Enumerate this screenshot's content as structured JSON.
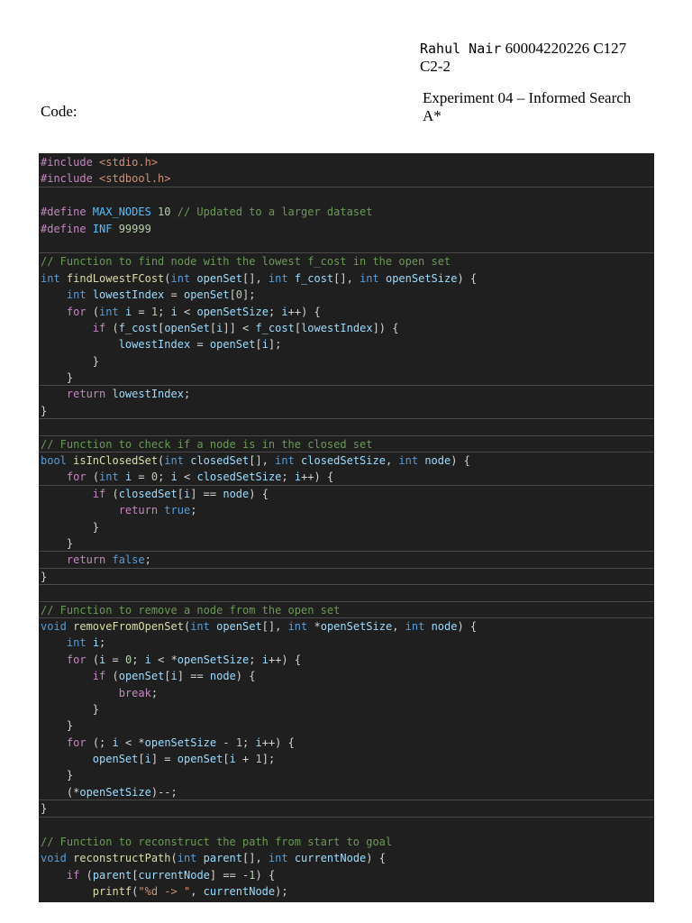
{
  "header": {
    "name": "Rahul  Nair",
    "id_line": " 60004220226 C127",
    "batch": "C2-2",
    "experiment_line1": "Experiment 04 – Informed Search",
    "experiment_line2": "A*",
    "code_label": "Code:"
  },
  "code_lines": [
    [
      [
        "kw",
        "#include "
      ],
      [
        "str",
        "<stdio.h>"
      ]
    ],
    [
      [
        "kw",
        "#include "
      ],
      [
        "str",
        "<stdbool.h>"
      ]
    ],
    [],
    [
      [
        "kw",
        "#define "
      ],
      [
        "mac",
        "MAX_NODES "
      ],
      [
        "num",
        "10 "
      ],
      [
        "com",
        "// Updated to a larger dataset"
      ]
    ],
    [
      [
        "kw",
        "#define "
      ],
      [
        "mac",
        "INF "
      ],
      [
        "num",
        "99999"
      ]
    ],
    [],
    [
      [
        "com",
        "// Function to find node with the lowest f_cost in the open set"
      ]
    ],
    [
      [
        "type",
        "int "
      ],
      [
        "fn",
        "findLowestFCost"
      ],
      [
        "p",
        "("
      ],
      [
        "type",
        "int "
      ],
      [
        "var",
        "openSet"
      ],
      [
        "p",
        "[], "
      ],
      [
        "type",
        "int "
      ],
      [
        "var",
        "f_cost"
      ],
      [
        "p",
        "[], "
      ],
      [
        "type",
        "int "
      ],
      [
        "var",
        "openSetSize"
      ],
      [
        "p",
        ") {"
      ]
    ],
    [
      [
        "p",
        "    "
      ],
      [
        "type",
        "int "
      ],
      [
        "var",
        "lowestIndex"
      ],
      [
        "p",
        " = "
      ],
      [
        "var",
        "openSet"
      ],
      [
        "p",
        "["
      ],
      [
        "num",
        "0"
      ],
      [
        "p",
        "];"
      ]
    ],
    [
      [
        "p",
        "    "
      ],
      [
        "kw",
        "for "
      ],
      [
        "p",
        "("
      ],
      [
        "type",
        "int "
      ],
      [
        "var",
        "i"
      ],
      [
        "p",
        " = "
      ],
      [
        "num",
        "1"
      ],
      [
        "p",
        "; "
      ],
      [
        "var",
        "i"
      ],
      [
        "p",
        " < "
      ],
      [
        "var",
        "openSetSize"
      ],
      [
        "p",
        "; "
      ],
      [
        "var",
        "i"
      ],
      [
        "p",
        "++) {"
      ]
    ],
    [
      [
        "p",
        "        "
      ],
      [
        "kw",
        "if "
      ],
      [
        "p",
        "("
      ],
      [
        "var",
        "f_cost"
      ],
      [
        "p",
        "["
      ],
      [
        "var",
        "openSet"
      ],
      [
        "p",
        "["
      ],
      [
        "var",
        "i"
      ],
      [
        "p",
        "]] < "
      ],
      [
        "var",
        "f_cost"
      ],
      [
        "p",
        "["
      ],
      [
        "var",
        "lowestIndex"
      ],
      [
        "p",
        "]) {"
      ]
    ],
    [
      [
        "p",
        "            "
      ],
      [
        "var",
        "lowestIndex"
      ],
      [
        "p",
        " = "
      ],
      [
        "var",
        "openSet"
      ],
      [
        "p",
        "["
      ],
      [
        "var",
        "i"
      ],
      [
        "p",
        "];"
      ]
    ],
    [
      [
        "p",
        "        }"
      ]
    ],
    [
      [
        "p",
        "    }"
      ]
    ],
    [
      [
        "p",
        "    "
      ],
      [
        "kw",
        "return "
      ],
      [
        "var",
        "lowestIndex"
      ],
      [
        "p",
        ";"
      ]
    ],
    [
      [
        "p",
        "}"
      ]
    ],
    [],
    [
      [
        "com",
        "// Function to check if a node is in the closed set"
      ]
    ],
    [
      [
        "type",
        "bool "
      ],
      [
        "fn",
        "isInClosedSet"
      ],
      [
        "p",
        "("
      ],
      [
        "type",
        "int "
      ],
      [
        "var",
        "closedSet"
      ],
      [
        "p",
        "[], "
      ],
      [
        "type",
        "int "
      ],
      [
        "var",
        "closedSetSize"
      ],
      [
        "p",
        ", "
      ],
      [
        "type",
        "int "
      ],
      [
        "var",
        "node"
      ],
      [
        "p",
        ") {"
      ]
    ],
    [
      [
        "p",
        "    "
      ],
      [
        "kw",
        "for "
      ],
      [
        "p",
        "("
      ],
      [
        "type",
        "int "
      ],
      [
        "var",
        "i"
      ],
      [
        "p",
        " = "
      ],
      [
        "num",
        "0"
      ],
      [
        "p",
        "; "
      ],
      [
        "var",
        "i"
      ],
      [
        "p",
        " < "
      ],
      [
        "var",
        "closedSetSize"
      ],
      [
        "p",
        "; "
      ],
      [
        "var",
        "i"
      ],
      [
        "p",
        "++) {"
      ]
    ],
    [
      [
        "p",
        "        "
      ],
      [
        "kw",
        "if "
      ],
      [
        "p",
        "("
      ],
      [
        "var",
        "closedSet"
      ],
      [
        "p",
        "["
      ],
      [
        "var",
        "i"
      ],
      [
        "p",
        "] == "
      ],
      [
        "var",
        "node"
      ],
      [
        "p",
        ") {"
      ]
    ],
    [
      [
        "p",
        "            "
      ],
      [
        "kw",
        "return "
      ],
      [
        "type",
        "true"
      ],
      [
        "p",
        ";"
      ]
    ],
    [
      [
        "p",
        "        }"
      ]
    ],
    [
      [
        "p",
        "    }"
      ]
    ],
    [
      [
        "p",
        "    "
      ],
      [
        "kw",
        "return "
      ],
      [
        "type",
        "false"
      ],
      [
        "p",
        ";"
      ]
    ],
    [
      [
        "p",
        "}"
      ]
    ],
    [],
    [
      [
        "com",
        "// Function to remove a node from the open set"
      ]
    ],
    [
      [
        "type",
        "void "
      ],
      [
        "fn",
        "removeFromOpenSet"
      ],
      [
        "p",
        "("
      ],
      [
        "type",
        "int "
      ],
      [
        "var",
        "openSet"
      ],
      [
        "p",
        "[], "
      ],
      [
        "type",
        "int "
      ],
      [
        "p",
        "*"
      ],
      [
        "var",
        "openSetSize"
      ],
      [
        "p",
        ", "
      ],
      [
        "type",
        "int "
      ],
      [
        "var",
        "node"
      ],
      [
        "p",
        ") {"
      ]
    ],
    [
      [
        "p",
        "    "
      ],
      [
        "type",
        "int "
      ],
      [
        "var",
        "i"
      ],
      [
        "p",
        ";"
      ]
    ],
    [
      [
        "p",
        "    "
      ],
      [
        "kw",
        "for "
      ],
      [
        "p",
        "("
      ],
      [
        "var",
        "i"
      ],
      [
        "p",
        " = "
      ],
      [
        "num",
        "0"
      ],
      [
        "p",
        "; "
      ],
      [
        "var",
        "i"
      ],
      [
        "p",
        " < *"
      ],
      [
        "var",
        "openSetSize"
      ],
      [
        "p",
        "; "
      ],
      [
        "var",
        "i"
      ],
      [
        "p",
        "++) {"
      ]
    ],
    [
      [
        "p",
        "        "
      ],
      [
        "kw",
        "if "
      ],
      [
        "p",
        "("
      ],
      [
        "var",
        "openSet"
      ],
      [
        "p",
        "["
      ],
      [
        "var",
        "i"
      ],
      [
        "p",
        "] == "
      ],
      [
        "var",
        "node"
      ],
      [
        "p",
        ") {"
      ]
    ],
    [
      [
        "p",
        "            "
      ],
      [
        "kw",
        "break"
      ],
      [
        "p",
        ";"
      ]
    ],
    [
      [
        "p",
        "        }"
      ]
    ],
    [
      [
        "p",
        "    }"
      ]
    ],
    [
      [
        "p",
        "    "
      ],
      [
        "kw",
        "for "
      ],
      [
        "p",
        "(; "
      ],
      [
        "var",
        "i"
      ],
      [
        "p",
        " < *"
      ],
      [
        "var",
        "openSetSize"
      ],
      [
        "p",
        " - "
      ],
      [
        "num",
        "1"
      ],
      [
        "p",
        "; "
      ],
      [
        "var",
        "i"
      ],
      [
        "p",
        "++) {"
      ]
    ],
    [
      [
        "p",
        "        "
      ],
      [
        "var",
        "openSet"
      ],
      [
        "p",
        "["
      ],
      [
        "var",
        "i"
      ],
      [
        "p",
        "] = "
      ],
      [
        "var",
        "openSet"
      ],
      [
        "p",
        "["
      ],
      [
        "var",
        "i"
      ],
      [
        "p",
        " + "
      ],
      [
        "num",
        "1"
      ],
      [
        "p",
        "];"
      ]
    ],
    [
      [
        "p",
        "    }"
      ]
    ],
    [
      [
        "p",
        "    (*"
      ],
      [
        "var",
        "openSetSize"
      ],
      [
        "p",
        ")--;"
      ]
    ],
    [
      [
        "p",
        "}"
      ]
    ],
    [],
    [
      [
        "com",
        "// Function to reconstruct the path from start to goal"
      ]
    ],
    [
      [
        "type",
        "void "
      ],
      [
        "fn",
        "reconstructPath"
      ],
      [
        "p",
        "("
      ],
      [
        "type",
        "int "
      ],
      [
        "var",
        "parent"
      ],
      [
        "p",
        "[], "
      ],
      [
        "type",
        "int "
      ],
      [
        "var",
        "currentNode"
      ],
      [
        "p",
        ") {"
      ]
    ],
    [
      [
        "p",
        "    "
      ],
      [
        "kw",
        "if "
      ],
      [
        "p",
        "("
      ],
      [
        "var",
        "parent"
      ],
      [
        "p",
        "["
      ],
      [
        "var",
        "currentNode"
      ],
      [
        "p",
        "] == -"
      ],
      [
        "num",
        "1"
      ],
      [
        "p",
        ") {"
      ]
    ],
    [
      [
        "p",
        "        "
      ],
      [
        "fn",
        "printf"
      ],
      [
        "p",
        "("
      ],
      [
        "str",
        "\"%d -> \""
      ],
      [
        "p",
        ", "
      ],
      [
        "var",
        "currentNode"
      ],
      [
        "p",
        ");"
      ]
    ]
  ]
}
